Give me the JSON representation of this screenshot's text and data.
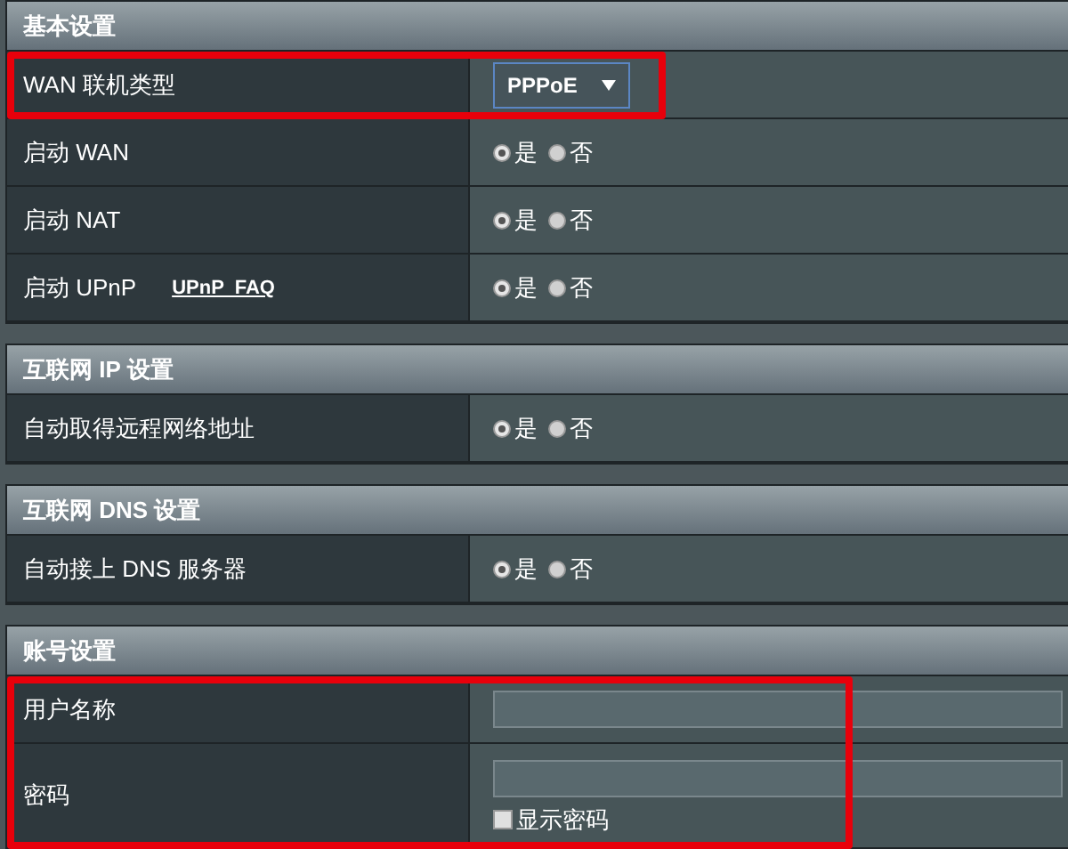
{
  "sections": [
    {
      "title": "基本设置",
      "rows": [
        {
          "kind": "select",
          "label": "WAN 联机类型",
          "value": "PPPoE",
          "highlighted": true
        },
        {
          "kind": "radio",
          "label": "启动 WAN",
          "options": [
            {
              "label": "是",
              "selected": true
            },
            {
              "label": "否",
              "selected": false
            }
          ],
          "highlighted": false
        },
        {
          "kind": "radio",
          "label": "启动 NAT",
          "options": [
            {
              "label": "是",
              "selected": true
            },
            {
              "label": "否",
              "selected": false
            }
          ],
          "highlighted": false
        },
        {
          "kind": "radio",
          "label": "启动 UPnP",
          "link": "UPnP  FAQ",
          "options": [
            {
              "label": "是",
              "selected": true
            },
            {
              "label": "否",
              "selected": false
            }
          ],
          "highlighted": false
        }
      ]
    },
    {
      "title": "互联网 IP 设置",
      "rows": [
        {
          "kind": "radio",
          "label": "自动取得远程网络地址",
          "options": [
            {
              "label": "是",
              "selected": true
            },
            {
              "label": "否",
              "selected": false
            }
          ],
          "highlighted": false
        }
      ]
    },
    {
      "title": "互联网 DNS 设置",
      "rows": [
        {
          "kind": "radio",
          "label": "自动接上 DNS 服务器",
          "options": [
            {
              "label": "是",
              "selected": true
            },
            {
              "label": "否",
              "selected": false
            }
          ],
          "highlighted": false
        }
      ]
    },
    {
      "title": "账号设置",
      "rows": [
        {
          "kind": "text",
          "label": "用户名称",
          "highlighted": true
        },
        {
          "kind": "password",
          "label": "密码",
          "checkbox": {
            "label": "显示密码",
            "checked": false
          },
          "highlighted": true
        }
      ]
    }
  ]
}
